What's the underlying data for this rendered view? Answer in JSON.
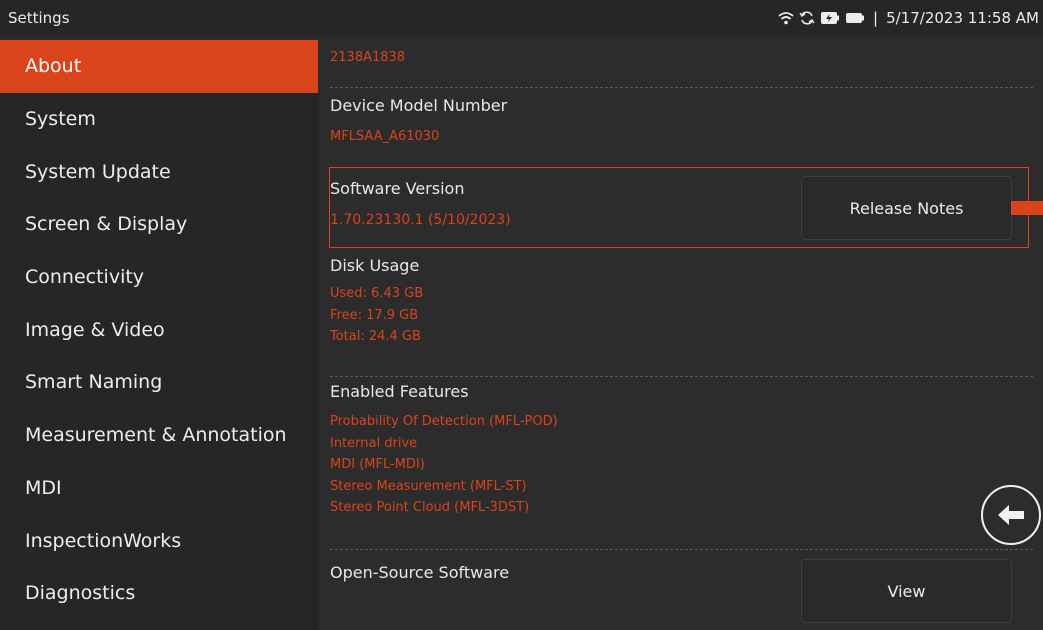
{
  "statusbar": {
    "title": "Settings",
    "datetime": "5/17/2023 11:58 AM",
    "icons": [
      "wifi-icon",
      "sync-icon",
      "battery-charging-icon",
      "battery-icon"
    ]
  },
  "sidebar": {
    "items": [
      {
        "label": "About",
        "active": true
      },
      {
        "label": "System"
      },
      {
        "label": "System Update"
      },
      {
        "label": "Screen & Display"
      },
      {
        "label": "Connectivity"
      },
      {
        "label": "Image & Video"
      },
      {
        "label": "Smart Naming"
      },
      {
        "label": "Measurement & Annotation"
      },
      {
        "label": "MDI"
      },
      {
        "label": "InspectionWorks"
      },
      {
        "label": "Diagnostics"
      }
    ]
  },
  "about": {
    "serial_value": "2138A1838",
    "model": {
      "label": "Device Model Number",
      "value": "MFLSAA_A61030"
    },
    "software": {
      "label": "Software Version",
      "value": "1.70.23130.1 (5/10/2023)",
      "button": "Release Notes"
    },
    "disk": {
      "label": "Disk Usage",
      "used": "Used: 6.43 GB",
      "free": "Free: 17.9 GB",
      "total": "Total: 24.4 GB"
    },
    "features": {
      "label": "Enabled Features",
      "items": [
        "Probability Of Detection (MFL-POD)",
        "Internal drive",
        "MDI (MFL-MDI)",
        "Stereo Measurement (MFL-ST)",
        "Stereo Point Cloud (MFL-3DST)"
      ]
    },
    "open_source": {
      "label": "Open-Source Software",
      "button": "View"
    }
  },
  "colors": {
    "accent": "#d9441c",
    "background": "#2c2c2c",
    "sidebar": "#262626"
  }
}
